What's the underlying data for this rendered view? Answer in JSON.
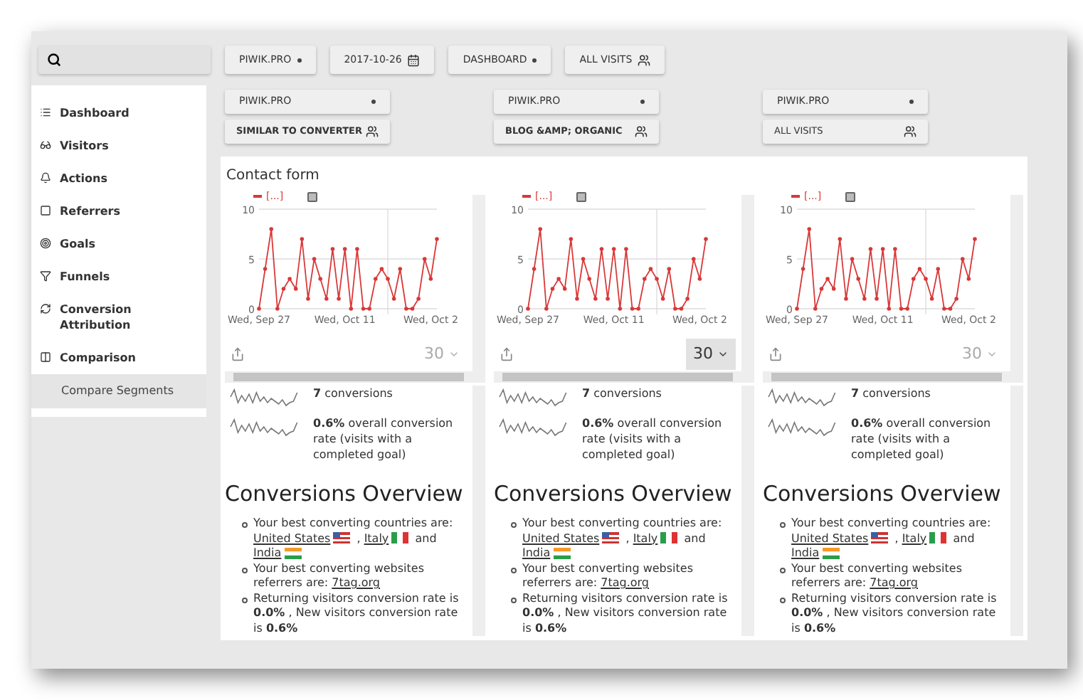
{
  "top_bar": {
    "buttons": [
      {
        "label": "PIWIK.PRO",
        "kind": "dropdown"
      },
      {
        "label": "2017-10-26",
        "kind": "date"
      },
      {
        "label": "DASHBOARD",
        "kind": "dropdown"
      },
      {
        "label": "ALL VISITS",
        "kind": "segment"
      }
    ]
  },
  "sidebar": {
    "items": [
      {
        "label": "Dashboard",
        "selected": false
      },
      {
        "label": "Visitors",
        "selected": false
      },
      {
        "label": "Actions",
        "selected": false
      },
      {
        "label": "Referrers",
        "selected": false
      },
      {
        "label": "Goals",
        "selected": false
      },
      {
        "label": "Funnels",
        "selected": false
      },
      {
        "label": "Conversion Attribution",
        "selected": false
      },
      {
        "label": "Comparison",
        "selected": false,
        "children": [
          {
            "label": "Compare Segments",
            "selected": true
          }
        ]
      }
    ]
  },
  "panel_title": "Contact form",
  "columns": [
    {
      "site": "PIWIK.PRO",
      "segment": "SIMILAR TO CONVERTER",
      "segment_bold": true,
      "chart_data": {
        "type": "line",
        "categories": [
          "Wed, Sep 27",
          null,
          null,
          null,
          null,
          null,
          null,
          null,
          null,
          null,
          null,
          null,
          null,
          null,
          "Wed, Oct 11",
          null,
          null,
          null,
          null,
          null,
          null,
          null,
          null,
          null,
          null,
          null,
          null,
          null,
          "Wed, Oct 2",
          null
        ],
        "series": [
          {
            "name": "[...]",
            "color": "#d93838",
            "values": [
              0,
              4,
              8,
              0,
              2,
              3,
              2,
              7,
              1,
              5,
              3,
              1,
              6,
              1,
              6,
              0,
              6,
              0,
              0,
              3,
              4,
              3,
              1,
              4,
              0,
              0,
              1,
              5,
              3,
              7
            ]
          }
        ],
        "ylim": [
          0,
          10
        ],
        "yticks": [
          0,
          5,
          10
        ]
      },
      "period": {
        "label": "30",
        "selected": false
      },
      "metrics": [
        "**7** conversions",
        "**0.6%** overall conversion rate (visits with a completed goal)"
      ],
      "overview_title": "Conversions Overview",
      "bullets": [
        [
          {
            "kind": "text",
            "text": "Your best converting countries are: "
          },
          {
            "kind": "link",
            "text": "United States",
            "has_flag": true
          },
          {
            "kind": "text",
            "text": " , "
          },
          {
            "kind": "link",
            "text": "Italy",
            "has_flag": true
          },
          {
            "kind": "text",
            "text": " and "
          },
          {
            "kind": "link",
            "text": "India",
            "has_flag": true
          }
        ],
        [
          {
            "kind": "text",
            "text": "Your best converting websites referrers are: "
          },
          {
            "kind": "link",
            "text": "7tag.org",
            "has_flag": false
          }
        ],
        [
          {
            "kind": "text",
            "text": "Returning visitors conversion rate is **0.0%** , New visitors conversion rate is **0.6%**"
          }
        ]
      ]
    },
    {
      "site": "PIWIK.PRO",
      "segment": "BLOG &AMP; ORGANIC",
      "segment_bold": true,
      "chart_data": {
        "type": "line",
        "categories": [
          "Wed, Sep 27",
          null,
          null,
          null,
          null,
          null,
          null,
          null,
          null,
          null,
          null,
          null,
          null,
          null,
          "Wed, Oct 11",
          null,
          null,
          null,
          null,
          null,
          null,
          null,
          null,
          null,
          null,
          null,
          null,
          null,
          "Wed, Oct 2",
          null
        ],
        "series": [
          {
            "name": "[...]",
            "color": "#d93838",
            "values": [
              0,
              4,
              8,
              0,
              2,
              3,
              2,
              7,
              1,
              5,
              3,
              1,
              6,
              1,
              6,
              0,
              6,
              0,
              0,
              3,
              4,
              3,
              1,
              4,
              0,
              0,
              1,
              5,
              3,
              7
            ]
          }
        ],
        "ylim": [
          0,
          10
        ],
        "yticks": [
          0,
          5,
          10
        ]
      },
      "period": {
        "label": "30",
        "selected": true
      },
      "metrics": [
        "**7** conversions",
        "**0.6%** overall conversion rate (visits with a completed goal)"
      ],
      "overview_title": "Conversions Overview",
      "bullets": [
        [
          {
            "kind": "text",
            "text": "Your best converting countries are: "
          },
          {
            "kind": "link",
            "text": "United States",
            "has_flag": true
          },
          {
            "kind": "text",
            "text": " , "
          },
          {
            "kind": "link",
            "text": "Italy",
            "has_flag": true
          },
          {
            "kind": "text",
            "text": " and "
          },
          {
            "kind": "link",
            "text": "India",
            "has_flag": true
          }
        ],
        [
          {
            "kind": "text",
            "text": "Your best converting websites referrers are: "
          },
          {
            "kind": "link",
            "text": "7tag.org",
            "has_flag": false
          }
        ],
        [
          {
            "kind": "text",
            "text": "Returning visitors conversion rate is **0.0%** , New visitors conversion rate is **0.6%**"
          }
        ]
      ]
    },
    {
      "site": "PIWIK.PRO",
      "segment": "ALL VISITS",
      "segment_bold": false,
      "chart_data": {
        "type": "line",
        "categories": [
          "Wed, Sep 27",
          null,
          null,
          null,
          null,
          null,
          null,
          null,
          null,
          null,
          null,
          null,
          null,
          null,
          "Wed, Oct 11",
          null,
          null,
          null,
          null,
          null,
          null,
          null,
          null,
          null,
          null,
          null,
          null,
          null,
          "Wed, Oct 2",
          null
        ],
        "series": [
          {
            "name": "[...]",
            "color": "#d93838",
            "values": [
              0,
              4,
              8,
              0,
              2,
              3,
              2,
              7,
              1,
              5,
              3,
              1,
              6,
              1,
              6,
              0,
              6,
              0,
              0,
              3,
              4,
              3,
              1,
              4,
              0,
              0,
              1,
              5,
              3,
              7
            ]
          }
        ],
        "ylim": [
          0,
          10
        ],
        "yticks": [
          0,
          5,
          10
        ]
      },
      "period": {
        "label": "30",
        "selected": false
      },
      "metrics": [
        "**7** conversions",
        "**0.6%** overall conversion rate (visits with a completed goal)"
      ],
      "overview_title": "Conversions Overview",
      "bullets": [
        [
          {
            "kind": "text",
            "text": "Your best converting countries are: "
          },
          {
            "kind": "link",
            "text": "United States",
            "has_flag": true
          },
          {
            "kind": "text",
            "text": " , "
          },
          {
            "kind": "link",
            "text": "Italy",
            "has_flag": true
          },
          {
            "kind": "text",
            "text": " and "
          },
          {
            "kind": "link",
            "text": "India",
            "has_flag": true
          }
        ],
        [
          {
            "kind": "text",
            "text": "Your best converting websites referrers are: "
          },
          {
            "kind": "link",
            "text": "7tag.org",
            "has_flag": false
          }
        ],
        [
          {
            "kind": "text",
            "text": "Returning visitors conversion rate is **0.0%** , New visitors conversion rate is **0.6%**"
          }
        ]
      ]
    }
  ]
}
